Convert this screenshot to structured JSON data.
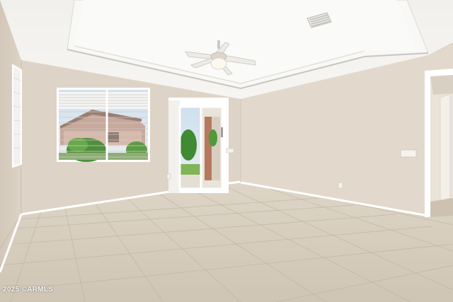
{
  "photo": {
    "watermark": "2025 ©ARMLS"
  },
  "palette": {
    "ceiling": "#f3f2ef",
    "ceiling_tray": "#f7f7f5",
    "wall_left": "#ddd3c6",
    "wall_back": "#e1d9cd",
    "wall_right": "#e3dacd",
    "floor": "#d8cfbf",
    "trim": "#ffffff"
  },
  "icons": [
    "ceiling-fan-icon",
    "air-vent-icon",
    "window-blinds",
    "sliding-glass-door"
  ]
}
